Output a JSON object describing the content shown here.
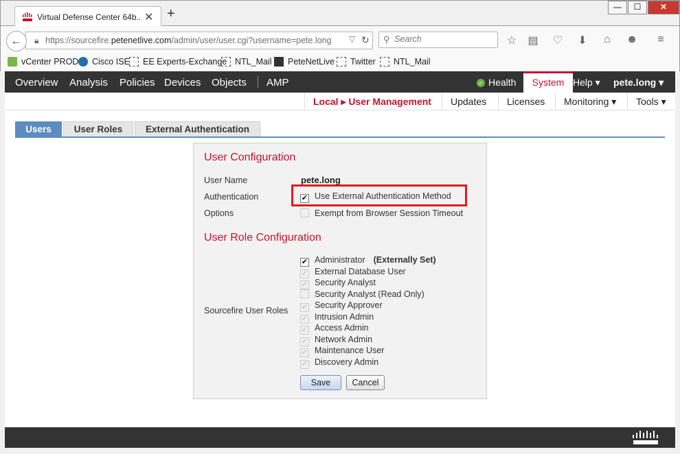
{
  "browser": {
    "tab_title": "Virtual Defense Center 64b...",
    "tab_close": "✕",
    "new_tab": "+",
    "window_controls": {
      "minimize": "—",
      "maximize": "☐",
      "close": "✕"
    },
    "url_prefix": "https://sourcefire.",
    "url_host": "petenetlive.com",
    "url_path": "/admin/user/user.cgi?username=pete.long",
    "search_placeholder": "Search",
    "toolbar_icons": [
      "star-icon",
      "reading-list-icon",
      "pocket-icon",
      "download-icon",
      "home-icon",
      "smiley-icon",
      "menu-icon"
    ]
  },
  "bookmarks": [
    {
      "label": "vCenter PROD",
      "icon": "vcenter-icon"
    },
    {
      "label": "Cisco ISE",
      "icon": "cisco-ise-icon"
    },
    {
      "label": "EE Experts-Exchange",
      "icon": "bookmark-icon"
    },
    {
      "label": "NTL_Mail",
      "icon": "bookmark-icon"
    },
    {
      "label": "PeteNetLive",
      "icon": "petenetlive-icon"
    },
    {
      "label": "Twitter",
      "icon": "bookmark-icon"
    },
    {
      "label": "NTL_Mail",
      "icon": "bookmark-icon"
    }
  ],
  "main_nav": {
    "items": [
      "Overview",
      "Analysis",
      "Policies",
      "Devices",
      "Objects",
      "AMP"
    ],
    "health": "Health",
    "system": "System",
    "help": "Help ▾",
    "user": "pete.long ▾"
  },
  "sub_nav": {
    "breadcrumb": "Local ▸ User Management",
    "items": [
      "Updates",
      "Licenses",
      "Monitoring ▾",
      "Tools ▾"
    ]
  },
  "page_tabs": [
    "Users",
    "User Roles",
    "External Authentication"
  ],
  "user_config": {
    "title": "User Configuration",
    "username_label": "User Name",
    "username_value": "pete.long",
    "auth_label": "Authentication",
    "auth_option": "Use External Authentication Method",
    "auth_checked": true,
    "options_label": "Options",
    "options_option": "Exempt from Browser Session Timeout",
    "options_checked": false
  },
  "role_config": {
    "title": "User Role Configuration",
    "roles_label": "Sourcefire User Roles",
    "externally_set": "(Externally Set)",
    "roles": [
      {
        "label": "Administrator",
        "checked": true,
        "enabled": true
      },
      {
        "label": "External Database User",
        "checked": true,
        "enabled": false
      },
      {
        "label": "Security Analyst",
        "checked": true,
        "enabled": false
      },
      {
        "label": "Security Analyst (Read Only)",
        "checked": false,
        "enabled": false
      },
      {
        "label": "Security Approver",
        "checked": true,
        "enabled": false
      },
      {
        "label": "Intrusion Admin",
        "checked": true,
        "enabled": false
      },
      {
        "label": "Access Admin",
        "checked": true,
        "enabled": false
      },
      {
        "label": "Network Admin",
        "checked": true,
        "enabled": false
      },
      {
        "label": "Maintenance User",
        "checked": true,
        "enabled": false
      },
      {
        "label": "Discovery Admin",
        "checked": true,
        "enabled": false
      }
    ]
  },
  "buttons": {
    "save": "Save",
    "cancel": "Cancel"
  },
  "colors": {
    "accent_red": "#c41230",
    "tab_blue": "#5c8dc0",
    "nav_dark": "#333333",
    "highlight_red": "#e01b1b"
  }
}
